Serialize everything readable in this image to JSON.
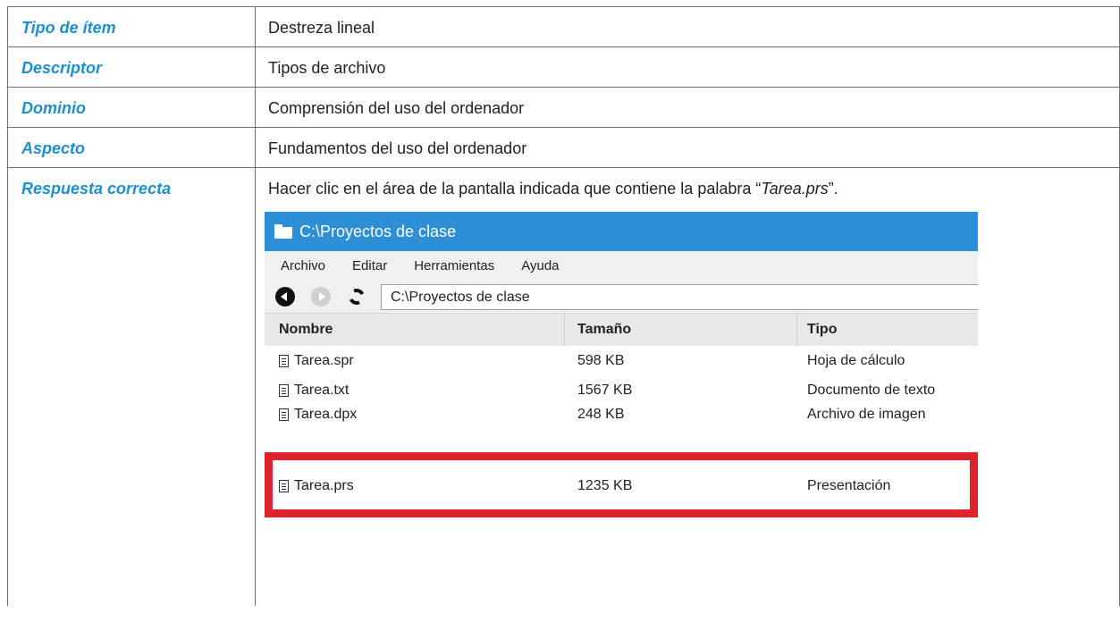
{
  "rows": [
    {
      "key": "Tipo de ítem",
      "value": "Destreza lineal"
    },
    {
      "key": "Descriptor",
      "value": "Tipos de archivo"
    },
    {
      "key": "Dominio",
      "value": "Comprensión del uso del ordenador"
    },
    {
      "key": "Aspecto",
      "value": "Fundamentos del uso del ordenador"
    }
  ],
  "answer": {
    "key": "Respuesta correcta",
    "text_before": "Hacer clic en el área de la pantalla indicada que contiene la palabra “",
    "text_em": "Tarea.prs",
    "text_after": "”."
  },
  "window": {
    "title": "C:\\Proyectos de clase",
    "menu": [
      "Archivo",
      "Editar",
      "Herramientas",
      "Ayuda"
    ],
    "address": "C:\\Proyectos de clase",
    "columns": [
      "Nombre",
      "Tamaño",
      "Tipo"
    ],
    "files": [
      {
        "name": "Tarea.spr",
        "size": "598 KB",
        "type": "Hoja de cálculo"
      },
      {
        "name": "Tarea.txt",
        "size": "1567 KB",
        "type": "Documento de texto"
      },
      {
        "name": "Tarea.dpx",
        "size": "248 KB",
        "type": "Archivo de imagen"
      },
      {
        "name": "Tarea.prs",
        "size": "1235 KB",
        "type": "Presentación"
      }
    ]
  },
  "colors": {
    "accent": "#1e8fce",
    "titlebar": "#2d8fd5",
    "highlight": "#e0222c"
  }
}
